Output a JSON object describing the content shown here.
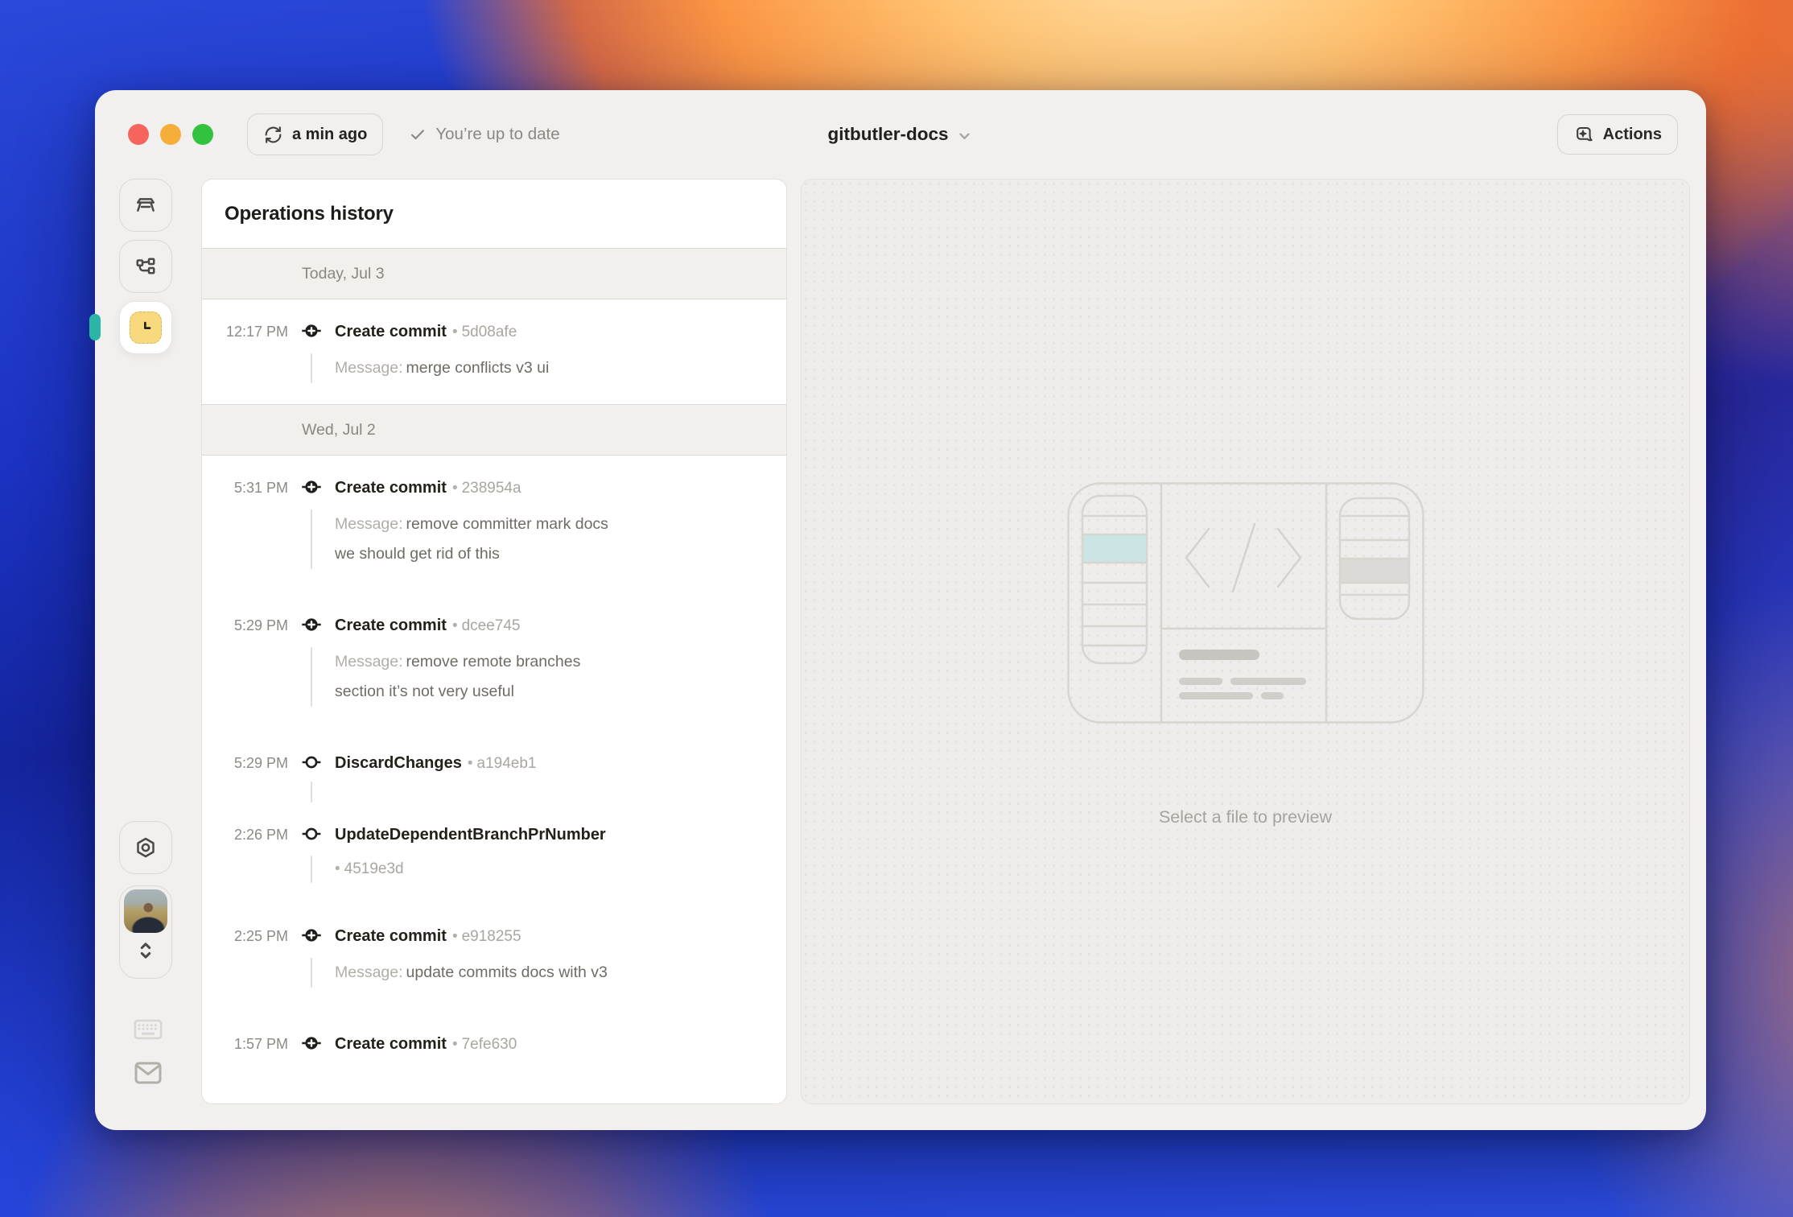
{
  "colors": {
    "accent_teal": "#2AB5A5",
    "history_active_yellow": "#F8D97E",
    "traffic_red": "#F5655E",
    "traffic_yellow": "#F6AE3B",
    "traffic_green": "#32C23E"
  },
  "titlebar": {
    "sync_button_label": "a min ago",
    "status_label": "You’re up to date",
    "project_name": "gitbutler-docs",
    "actions_label": "Actions"
  },
  "sidebar": {
    "top_items": [
      {
        "icon": "workbench-icon",
        "active": false
      },
      {
        "icon": "branches-icon",
        "active": false
      },
      {
        "icon": "history-clock-icon",
        "active": true
      }
    ],
    "bottom_items": [
      {
        "icon": "settings-hexagon-icon"
      },
      {
        "icon": "user-avatar-switcher"
      },
      {
        "icon": "keyboard-icon"
      },
      {
        "icon": "mail-icon"
      }
    ]
  },
  "history": {
    "title": "Operations history",
    "message_label": "Message:",
    "bullet": "•",
    "groups": [
      {
        "date": "Today, Jul 3",
        "entries": [
          {
            "time": "12:17 PM",
            "operation": "Create commit",
            "sha": "5d08afe",
            "message_lines": [
              "merge conflicts v3 ui"
            ]
          }
        ]
      },
      {
        "date": "Wed, Jul 2",
        "entries": [
          {
            "time": "5:31 PM",
            "operation": "Create commit",
            "sha": "238954a",
            "message_lines": [
              "remove committer mark docs",
              "we should get rid of this"
            ]
          },
          {
            "time": "5:29 PM",
            "operation": "Create commit",
            "sha": "dcee745",
            "message_lines": [
              "remove remote branches",
              "section it’s not very useful"
            ]
          },
          {
            "time": "5:29 PM",
            "operation": "DiscardChanges",
            "sha": "a194eb1",
            "message_lines": []
          },
          {
            "time": "2:26 PM",
            "operation": "UpdateDependentBranchPrNumber",
            "sha": "4519e3d",
            "sha_below": true,
            "message_lines": []
          },
          {
            "time": "2:25 PM",
            "operation": "Create commit",
            "sha": "e918255",
            "message_lines": [
              "update commits docs with v3"
            ]
          },
          {
            "time": "1:57 PM",
            "operation": "Create commit",
            "sha": "7efe630",
            "message_lines": []
          }
        ]
      }
    ]
  },
  "preview": {
    "placeholder": "Select a file to preview"
  }
}
